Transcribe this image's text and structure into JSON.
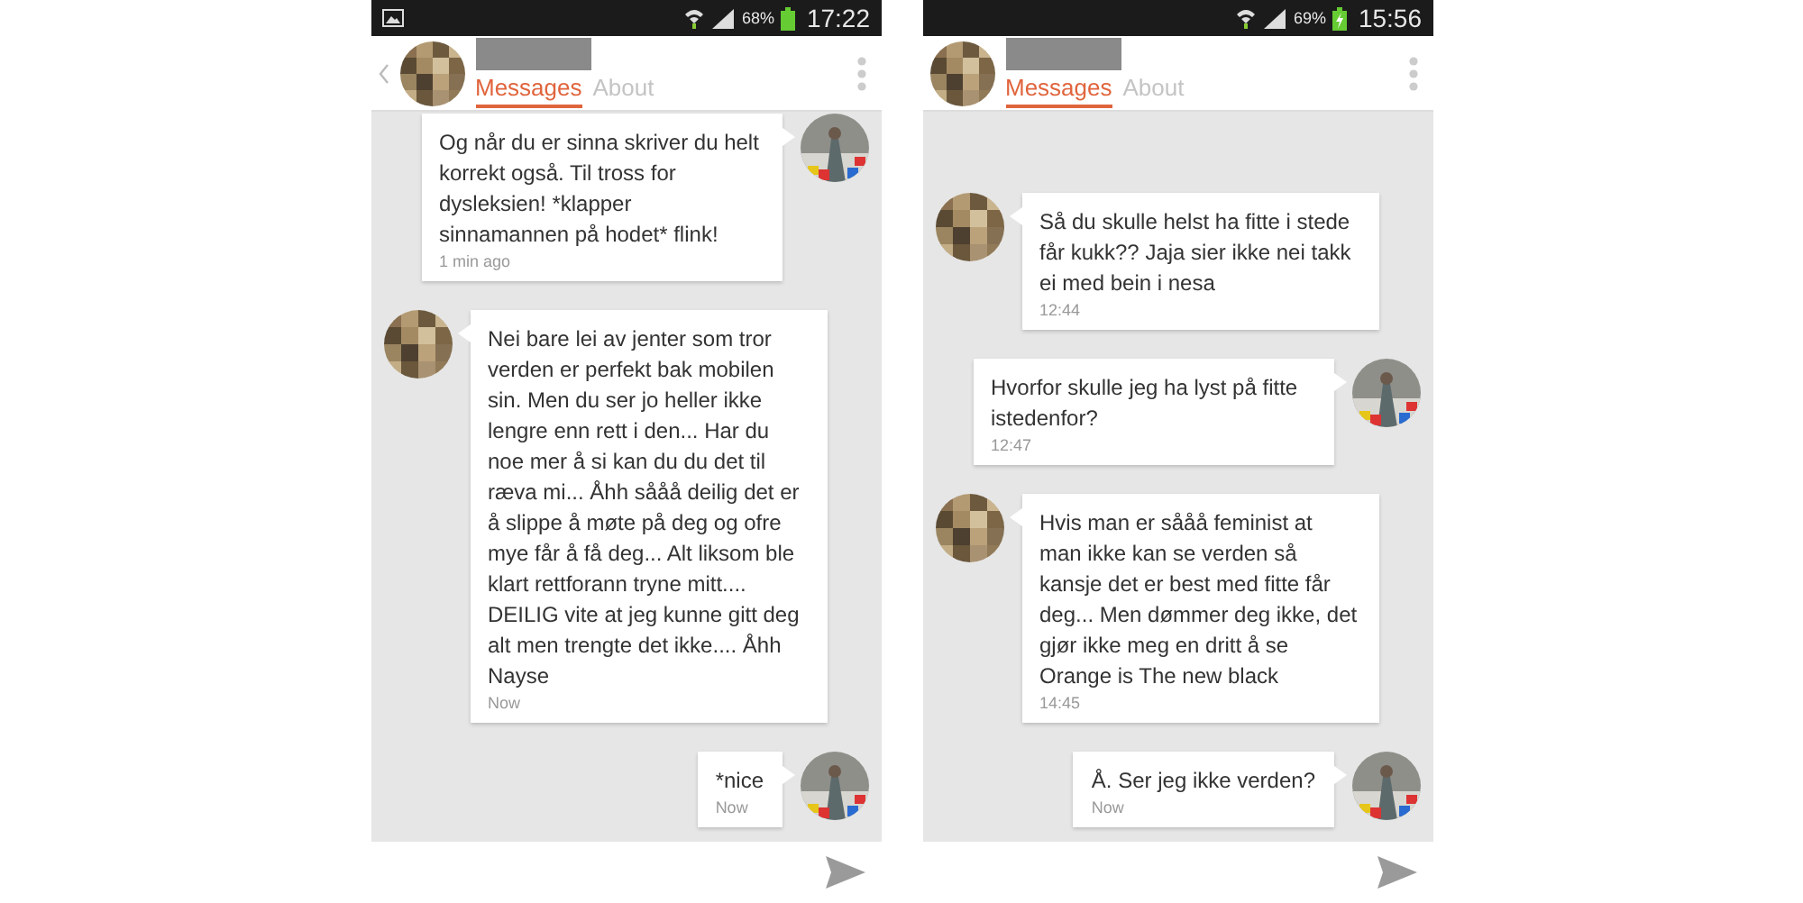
{
  "phones": [
    {
      "status_bar": {
        "notification_icon": true,
        "battery": "68%",
        "charging": false,
        "time": "17:22"
      },
      "header": {
        "back": true,
        "tabs": [
          {
            "label": "Messages",
            "selected": true
          },
          {
            "label": "About",
            "selected": false
          }
        ]
      },
      "messages": [
        {
          "kind": "sent",
          "text": "Og når du er sinna skriver du helt korrekt også.  Til tross for dysleksien! *klapper sinnamannen på hodet* flink!",
          "time": "1 min ago"
        },
        {
          "kind": "received",
          "text": "Nei bare lei av jenter som tror verden er perfekt bak mobilen sin. Men du ser jo heller ikke lengre enn rett i den... Har du noe mer å si kan du du det til ræva mi... Åhh sååå deilig det er å slippe å møte på deg og ofre mye får å få deg... Alt liksom ble klart rettforann tryne mitt.... DEILIG vite at jeg kunne gitt deg alt men trengte det ikke.... Åhh Nayse",
          "time": "Now"
        },
        {
          "kind": "sent",
          "text": "*nice",
          "time": "Now"
        }
      ]
    },
    {
      "status_bar": {
        "notification_icon": false,
        "battery": "69%",
        "charging": true,
        "time": "15:56"
      },
      "header": {
        "back": false,
        "tabs": [
          {
            "label": "Messages",
            "selected": true
          },
          {
            "label": "About",
            "selected": false
          }
        ]
      },
      "messages": [
        {
          "kind": "received",
          "text": "Så du skulle helst ha fitte i stede får kukk??  Jaja sier ikke nei takk ei med bein i nesa",
          "time": "12:44"
        },
        {
          "kind": "sent",
          "text": "Hvorfor skulle jeg ha lyst på fitte istedenfor?",
          "time": "12:47"
        },
        {
          "kind": "received",
          "text": "Hvis man er sååå feminist at man ikke kan se verden så kansje det er best med fitte får deg... Men dømmer deg ikke, det gjør ikke meg en dritt å se Orange is The new black",
          "time": "14:45"
        },
        {
          "kind": "sent",
          "text": "Å. Ser jeg ikke verden?",
          "time": "Now"
        }
      ]
    }
  ]
}
